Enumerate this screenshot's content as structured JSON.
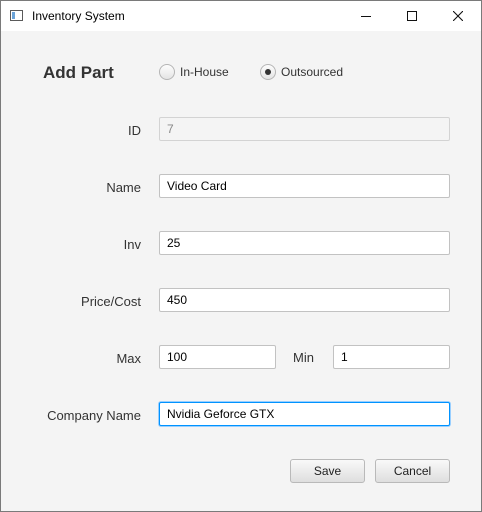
{
  "window": {
    "title": "Inventory System"
  },
  "form": {
    "heading": "Add Part",
    "source_options": [
      {
        "label": "In-House",
        "checked": false
      },
      {
        "label": "Outsourced",
        "checked": true
      }
    ],
    "id": {
      "label": "ID",
      "value": "7"
    },
    "name": {
      "label": "Name",
      "value": "Video Card"
    },
    "inv": {
      "label": "Inv",
      "value": "25"
    },
    "price": {
      "label": "Price/Cost",
      "value": "450"
    },
    "max": {
      "label": "Max",
      "value": "100"
    },
    "min": {
      "label": "Min",
      "value": "1"
    },
    "company": {
      "label": "Company Name",
      "value": "Nvidia Geforce GTX"
    }
  },
  "buttons": {
    "save": "Save",
    "cancel": "Cancel"
  },
  "colors": {
    "focus": "#0093ff",
    "background": "#f4f4f4"
  }
}
